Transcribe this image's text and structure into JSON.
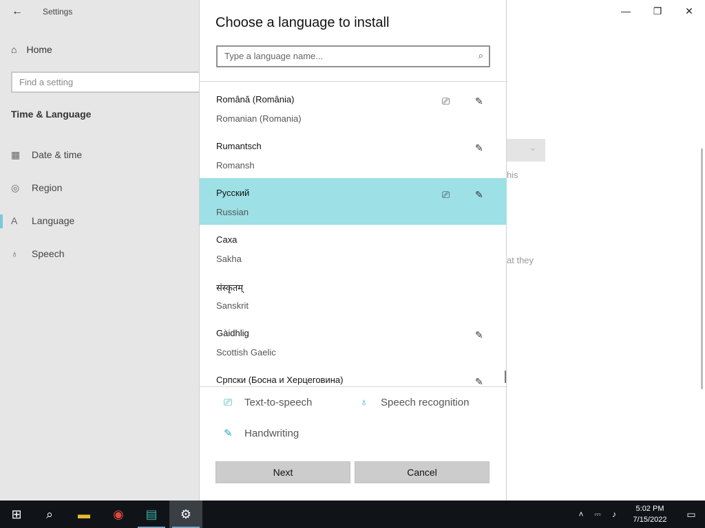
{
  "settings_window": {
    "title": "Settings",
    "home_label": "Home",
    "search_placeholder": "Find a setting",
    "section_title": "Time & Language",
    "nav": [
      {
        "label": "Date & time",
        "icon": "calendar-icon"
      },
      {
        "label": "Region",
        "icon": "globe-icon"
      },
      {
        "label": "Language",
        "icon": "language-icon",
        "active": true
      },
      {
        "label": "Speech",
        "icon": "microphone-icon"
      }
    ],
    "ghost_text_1": "his",
    "ghost_text_2": "at they"
  },
  "dialog": {
    "title": "Choose a language to install",
    "search_placeholder": "Type a language name...",
    "languages": [
      {
        "native": "Română (România)",
        "english": "Romanian (Romania)",
        "tts": true,
        "handwriting": true,
        "selected": false
      },
      {
        "native": "Rumantsch",
        "english": "Romansh",
        "tts": false,
        "handwriting": true,
        "selected": false
      },
      {
        "native": "Русский",
        "english": "Russian",
        "tts": true,
        "handwriting": true,
        "selected": true
      },
      {
        "native": "Саха",
        "english": "Sakha",
        "tts": false,
        "handwriting": false,
        "selected": false
      },
      {
        "native": "संस्कृतम्",
        "english": "Sanskrit",
        "tts": false,
        "handwriting": false,
        "selected": false
      },
      {
        "native": "Gàidhlig",
        "english": "Scottish Gaelic",
        "tts": false,
        "handwriting": true,
        "selected": false
      },
      {
        "native": "Српски (Босна и Херцеговина)",
        "english": "",
        "tts": false,
        "handwriting": true,
        "selected": false
      }
    ],
    "legend": {
      "tts": "Text-to-speech",
      "speech": "Speech recognition",
      "handwriting": "Handwriting"
    },
    "next_label": "Next",
    "cancel_label": "Cancel"
  },
  "taskbar": {
    "time": "5:02 PM",
    "date": "7/15/2022"
  },
  "colors": {
    "selected_row": "#9de0e6",
    "accent_icon": "#2aa8b8"
  }
}
